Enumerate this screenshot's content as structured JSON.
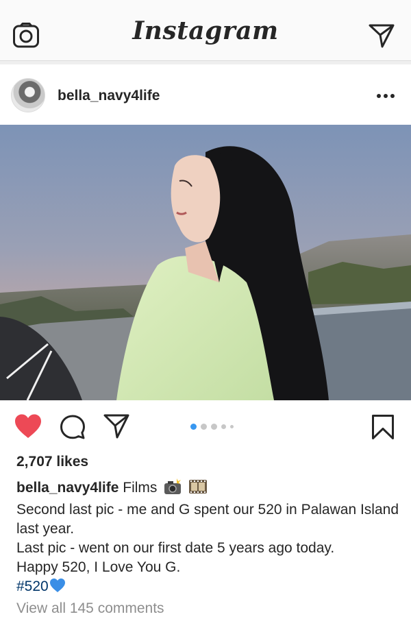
{
  "header": {
    "logo_text": "Instagram",
    "left_icon": "camera-icon",
    "right_icon": "direct-send-icon"
  },
  "post": {
    "username": "bella_navy4life",
    "more_icon": "more-options-icon",
    "likes": "2,707 likes",
    "carousel": {
      "count": 5,
      "active_index": 0
    },
    "caption": {
      "username": "bella_navy4life",
      "first_text": "Films",
      "lines": [
        "Second last pic - me and G spent our 520 in Palawan Island last year.",
        "Last pic - went on our first date 5 years ago today.",
        "Happy 520, I Love You G."
      ],
      "hashtag": "#520"
    },
    "view_comments": "View all 145 comments"
  },
  "colors": {
    "like_red": "#ed4956",
    "link_blue": "#003569",
    "carousel_active": "#3897f0",
    "muted_text": "#8e8e8e"
  }
}
